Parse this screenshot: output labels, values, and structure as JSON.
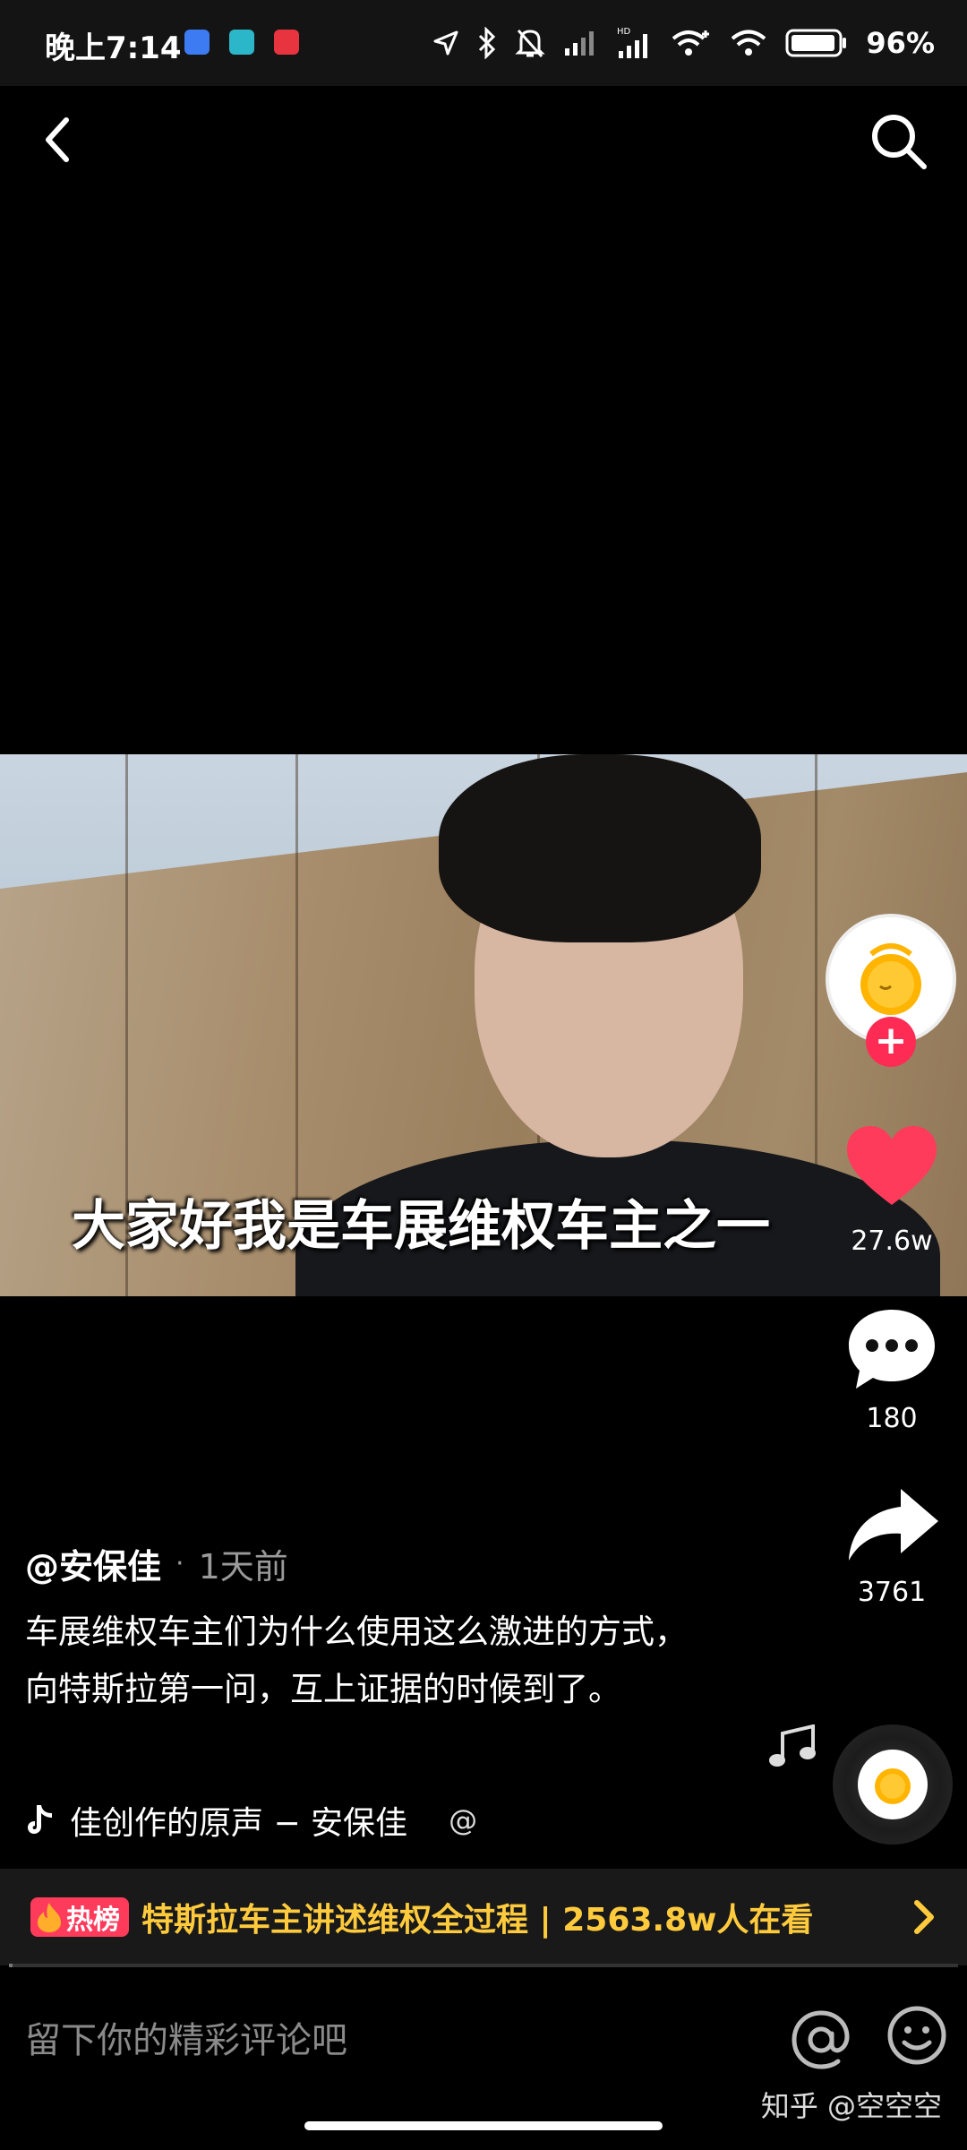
{
  "status_bar": {
    "time": "晚上7:14",
    "battery": "96%",
    "icons": [
      "location-icon",
      "bluetooth-icon",
      "mute-icon",
      "signal-icon",
      "signal-hd-icon",
      "wifi-plus-icon",
      "wifi-icon",
      "battery-icon"
    ]
  },
  "video": {
    "subtitle": "大家好我是车展维权车主之一",
    "progress": 0.004
  },
  "side": {
    "like_count": "27.6w",
    "comment_count": "180",
    "share_count": "3761"
  },
  "caption": {
    "author": "@安保佳",
    "separator": "·",
    "time_ago": "1天前",
    "description": "车展维权车主们为什么使用这么激进的方式，向特斯拉第一问，互上证据的时候到了。"
  },
  "music": {
    "title": "佳创作的原声 − 安保佳",
    "at": "@"
  },
  "hot": {
    "badge": "热榜",
    "title": "特斯拉车主讲述维权全过程 | 2563.8w人在看"
  },
  "comment_bar": {
    "placeholder": "留下你的精彩评论吧"
  },
  "watermark": "知乎 @空空空",
  "colors": {
    "accent_red": "#fe2c55",
    "hot_yellow": "#ffcb3d",
    "like_red": "#ff3b5c"
  }
}
